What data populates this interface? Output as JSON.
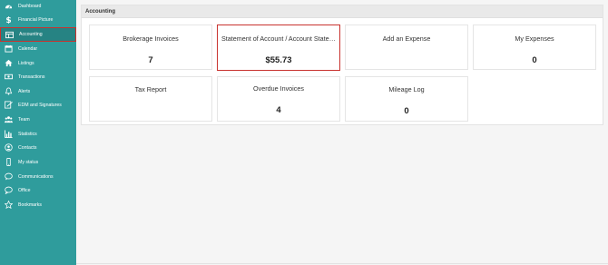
{
  "sidebar": {
    "items": [
      {
        "label": "Dashboard",
        "icon": "dashboard-icon"
      },
      {
        "label": "Financial Picture",
        "icon": "dollar-icon"
      },
      {
        "label": "Accounting",
        "icon": "ledger-icon",
        "active": true
      },
      {
        "label": "Calendar",
        "icon": "calendar-icon"
      },
      {
        "label": "Listings",
        "icon": "home-icon"
      },
      {
        "label": "Transactions",
        "icon": "money-icon"
      },
      {
        "label": "Alerts",
        "icon": "bell-icon"
      },
      {
        "label": "EDM and Signatures",
        "icon": "signature-icon"
      },
      {
        "label": "Team",
        "icon": "team-icon"
      },
      {
        "label": "Statistics",
        "icon": "bar-chart-icon"
      },
      {
        "label": "Contacts",
        "icon": "contacts-icon"
      },
      {
        "label": "My status",
        "icon": "mobile-icon"
      },
      {
        "label": "Communications",
        "icon": "chat-icon"
      },
      {
        "label": "Office",
        "icon": "speech-icon"
      },
      {
        "label": "Bookmarks",
        "icon": "star-icon"
      }
    ]
  },
  "panel": {
    "title": "Accounting"
  },
  "cards": [
    {
      "label": "Brokerage Invoices",
      "value": "7"
    },
    {
      "label": "Statement of Account / Account Statement",
      "value": "$55.73"
    },
    {
      "label": "Add an Expense",
      "value": ""
    },
    {
      "label": "My Expenses",
      "value": "0"
    },
    {
      "label": "Tax Report",
      "value": ""
    },
    {
      "label": "Overdue Invoices",
      "value": "4"
    },
    {
      "label": "Mileage Log",
      "value": "0"
    }
  ],
  "colors": {
    "sidebar": "#2f9c9c",
    "sidebar_active": "#268383",
    "highlight_border": "#c8322e"
  }
}
